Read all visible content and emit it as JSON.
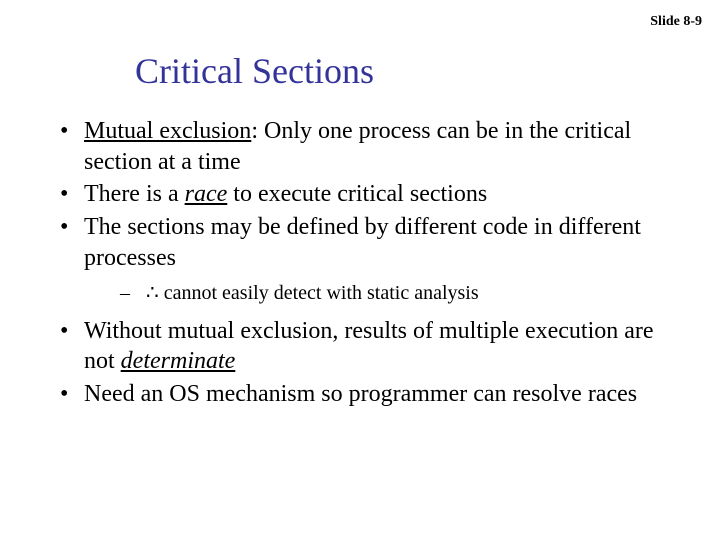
{
  "header": {
    "slide_number": "Slide 8-9"
  },
  "title": "Critical Sections",
  "bullets": {
    "b1_term": "Mutual exclusion",
    "b1_rest": ": Only one process can be in the critical section at a time",
    "b2_a": "There is a ",
    "b2_term": "race",
    "b2_b": " to execute critical sections",
    "b3": "The sections may be defined by different code in different processes",
    "sub1_sym": "∴",
    "sub1_text": " cannot easily detect with static analysis",
    "b4_a": "Without mutual exclusion, results of multiple execution are not ",
    "b4_term": "determinate",
    "b5": "Need an OS mechanism so programmer can resolve races"
  }
}
